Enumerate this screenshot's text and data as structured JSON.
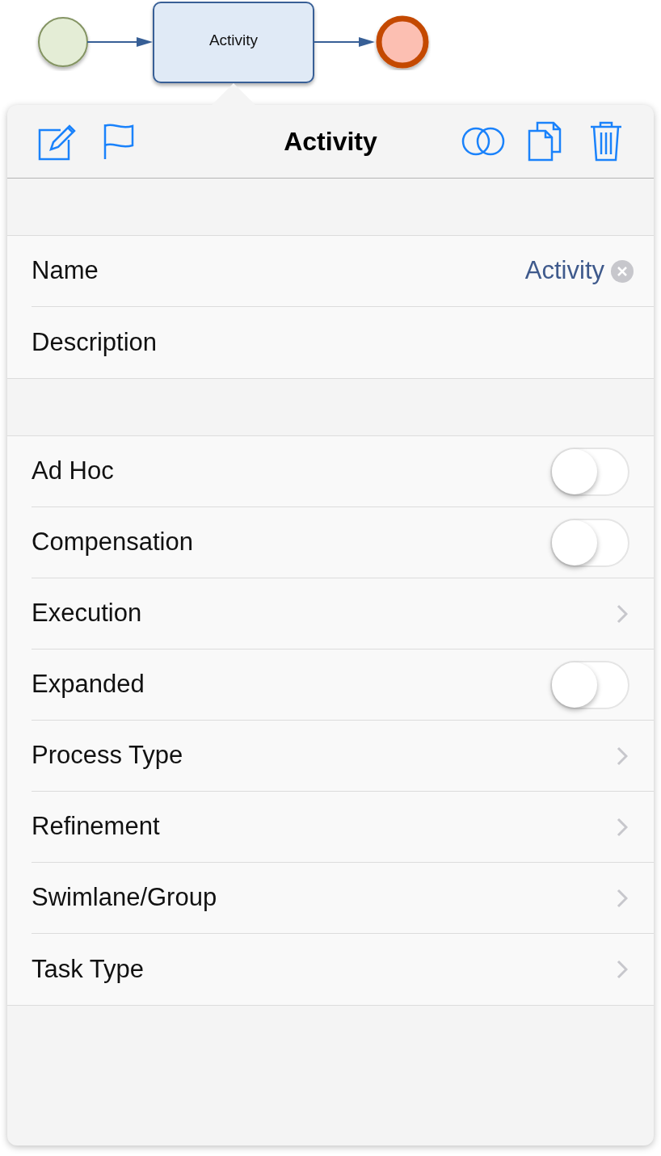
{
  "diagram": {
    "nodes": [
      {
        "kind": "start"
      },
      {
        "kind": "task",
        "label": "Activity"
      },
      {
        "kind": "end"
      }
    ]
  },
  "popover": {
    "title": "Activity",
    "sections": [
      {
        "rows": [
          {
            "kind": "text",
            "label": "Name",
            "value": "Activity",
            "clearable": true
          },
          {
            "kind": "text",
            "label": "Description"
          }
        ]
      },
      {
        "rows": [
          {
            "kind": "switch",
            "label": "Ad Hoc",
            "on": false
          },
          {
            "kind": "switch",
            "label": "Compensation",
            "on": false
          },
          {
            "kind": "link",
            "label": "Execution"
          },
          {
            "kind": "switch",
            "label": "Expanded",
            "on": false
          },
          {
            "kind": "link",
            "label": "Process Type"
          },
          {
            "kind": "link",
            "label": "Refinement"
          },
          {
            "kind": "link",
            "label": "Swimlane/Group"
          },
          {
            "kind": "link",
            "label": "Task Type"
          }
        ]
      }
    ]
  }
}
